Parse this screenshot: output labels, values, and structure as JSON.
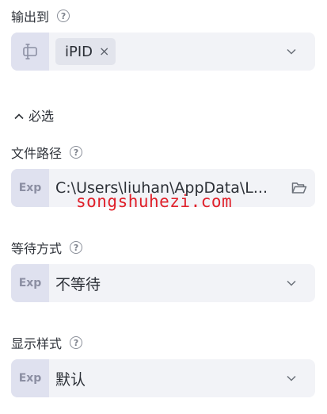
{
  "output_to": {
    "label": "输出到",
    "help": "?",
    "tag_value": "iPID",
    "tag_close": "×"
  },
  "required_section": {
    "toggle_glyph": "^",
    "label": "必选"
  },
  "file_path": {
    "label": "文件路径",
    "help": "?",
    "prefix": "Exp",
    "value": "C:\\Users\\liuhan\\AppData\\L..."
  },
  "wait_mode": {
    "label": "等待方式",
    "help": "?",
    "prefix": "Exp",
    "value": "不等待"
  },
  "display_style": {
    "label": "显示样式",
    "help": "?",
    "prefix": "Exp",
    "value": "默认"
  },
  "watermark": "songshuhezi.com",
  "colors": {
    "field_bg": "#f2f3f7",
    "prefix_bg": "#dfe1ef",
    "watermark": "#e0202a"
  },
  "icons": {
    "help": "help-circle-icon",
    "variable": "variable-input-icon",
    "chevron": "chevron-down-icon",
    "folder": "folder-open-icon"
  }
}
